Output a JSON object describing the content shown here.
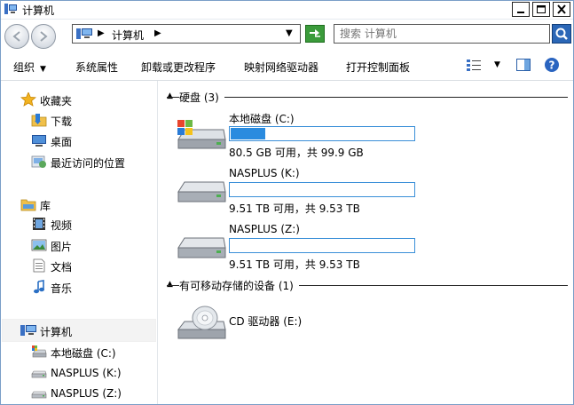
{
  "window": {
    "title": "计算机"
  },
  "address": {
    "location": "计算机",
    "search_placeholder": "搜索 计算机"
  },
  "toolbar": {
    "organize": "组织",
    "system_properties": "系统属性",
    "uninstall": "卸载或更改程序",
    "map_drive": "映射网络驱动器",
    "control_panel": "打开控制面板"
  },
  "sidebar": {
    "favorites": {
      "label": "收藏夹",
      "items": [
        {
          "label": "下载"
        },
        {
          "label": "桌面"
        },
        {
          "label": "最近访问的位置"
        }
      ]
    },
    "libraries": {
      "label": "库",
      "items": [
        {
          "label": "视频"
        },
        {
          "label": "图片"
        },
        {
          "label": "文档"
        },
        {
          "label": "音乐"
        }
      ]
    },
    "computer": {
      "label": "计算机",
      "items": [
        {
          "label": "本地磁盘 (C:)"
        },
        {
          "label": "NASPLUS (K:)"
        },
        {
          "label": "NASPLUS (Z:)"
        }
      ]
    }
  },
  "content": {
    "hard_disks": {
      "title": "硬盘 (3)",
      "drives": [
        {
          "name": "本地磁盘 (C:)",
          "info": "80.5 GB 可用，共 99.9 GB",
          "used_fraction": 0.19
        },
        {
          "name": "NASPLUS (K:)",
          "info": "9.51 TB 可用，共 9.53 TB",
          "used_fraction": 0.002
        },
        {
          "name": "NASPLUS (Z:)",
          "info": "9.51 TB 可用，共 9.53 TB",
          "used_fraction": 0.002
        }
      ]
    },
    "removable": {
      "title": "有可移动存储的设备 (1)",
      "devices": [
        {
          "name": "CD 驱动器 (E:)"
        }
      ]
    }
  },
  "colors": {
    "bar_fill": "#2a8bdf",
    "bar_border": "#3a8fd8",
    "window_border": "#7a9ec7"
  }
}
